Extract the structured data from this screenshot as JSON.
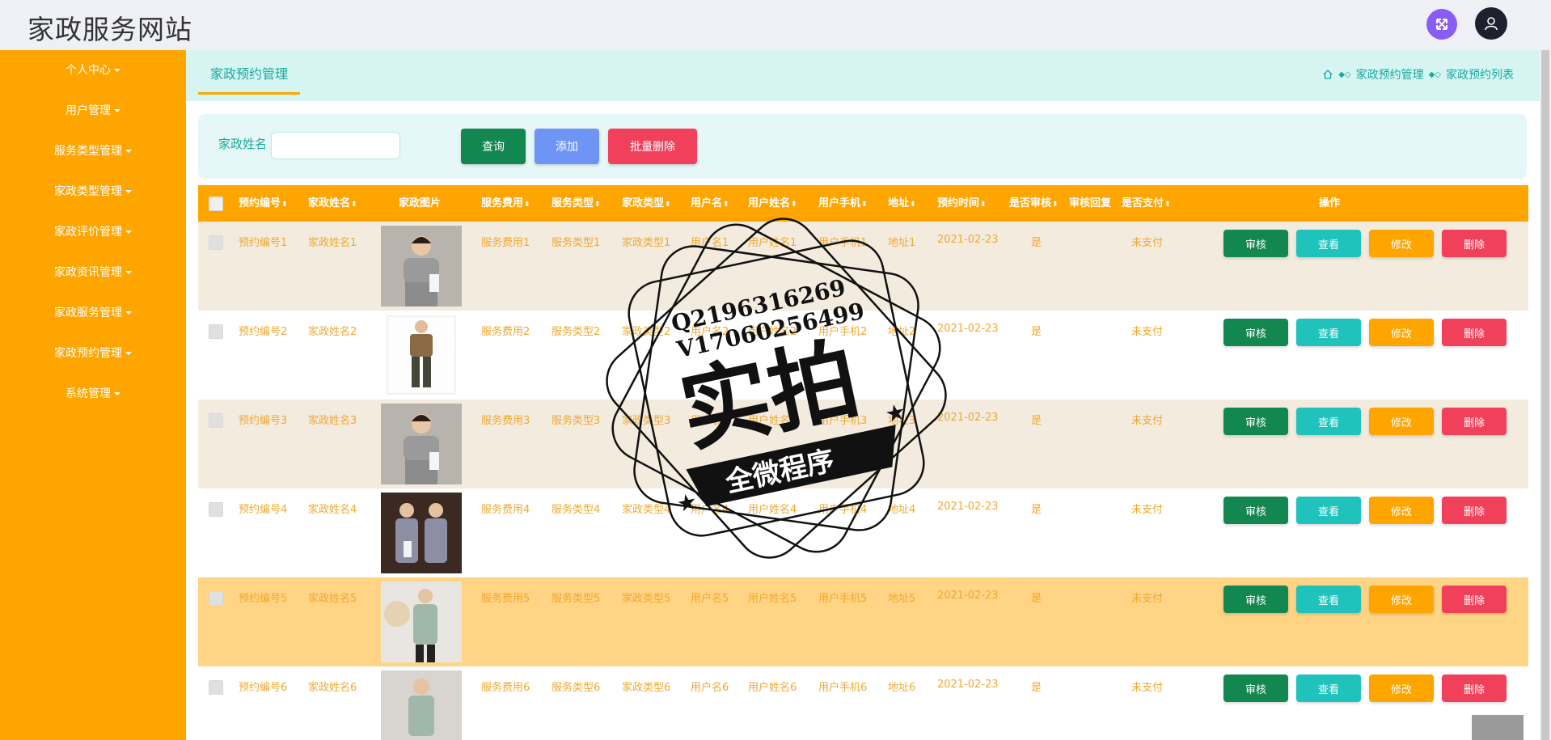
{
  "header": {
    "title": "家政服务网站"
  },
  "sidebar": {
    "items": [
      {
        "label": "个人中心"
      },
      {
        "label": "用户管理"
      },
      {
        "label": "服务类型管理"
      },
      {
        "label": "家政类型管理"
      },
      {
        "label": "家政评价管理"
      },
      {
        "label": "家政资讯管理"
      },
      {
        "label": "家政服务管理"
      },
      {
        "label": "家政预约管理"
      },
      {
        "label": "系统管理"
      }
    ]
  },
  "page": {
    "tab": "家政预约管理",
    "breadcrumb": [
      "家政预约管理",
      "家政预约列表"
    ]
  },
  "search": {
    "label": "家政姓名",
    "value": "",
    "placeholder": "",
    "query_label": "查询",
    "add_label": "添加",
    "batch_delete_label": "批量删除"
  },
  "table": {
    "headers": [
      "预约编号",
      "家政姓名",
      "家政图片",
      "服务费用",
      "服务类型",
      "家政类型",
      "用户名",
      "用户姓名",
      "用户手机",
      "地址",
      "预约时间",
      "是否审核",
      "审核回复",
      "是否支付",
      "操作"
    ],
    "rows": [
      {
        "id": "预约编号1",
        "name": "家政姓名1",
        "fee": "服务费用1",
        "stype": "服务类型1",
        "htype": "家政类型1",
        "user": "用户名1",
        "uname": "用户姓名1",
        "phone": "用户手机1",
        "addr": "地址1",
        "time": "2021-02-23",
        "audit": "是",
        "reply": "",
        "paid": "未支付"
      },
      {
        "id": "预约编号2",
        "name": "家政姓名2",
        "fee": "服务费用2",
        "stype": "服务类型2",
        "htype": "家政类型2",
        "user": "用户名2",
        "uname": "用户姓名2",
        "phone": "用户手机2",
        "addr": "地址2",
        "time": "2021-02-23",
        "audit": "是",
        "reply": "",
        "paid": "未支付"
      },
      {
        "id": "预约编号3",
        "name": "家政姓名3",
        "fee": "服务费用3",
        "stype": "服务类型3",
        "htype": "家政类型3",
        "user": "用户名3",
        "uname": "用户姓名3",
        "phone": "用户手机3",
        "addr": "地址3",
        "time": "2021-02-23",
        "audit": "是",
        "reply": "",
        "paid": "未支付"
      },
      {
        "id": "预约编号4",
        "name": "家政姓名4",
        "fee": "服务费用4",
        "stype": "服务类型4",
        "htype": "家政类型4",
        "user": "用户名4",
        "uname": "用户姓名4",
        "phone": "用户手机4",
        "addr": "地址4",
        "time": "2021-02-23",
        "audit": "是",
        "reply": "",
        "paid": "未支付"
      },
      {
        "id": "预约编号5",
        "name": "家政姓名5",
        "fee": "服务费用5",
        "stype": "服务类型5",
        "htype": "家政类型5",
        "user": "用户名5",
        "uname": "用户姓名5",
        "phone": "用户手机5",
        "addr": "地址5",
        "time": "2021-02-23",
        "audit": "是",
        "reply": "",
        "paid": "未支付"
      },
      {
        "id": "预约编号6",
        "name": "家政姓名6",
        "fee": "服务费用6",
        "stype": "服务类型6",
        "htype": "家政类型6",
        "user": "用户名6",
        "uname": "用户姓名6",
        "phone": "用户手机6",
        "addr": "地址6",
        "time": "2021-02-23",
        "audit": "是",
        "reply": "",
        "paid": "未支付"
      }
    ],
    "actions": {
      "audit": "审核",
      "view": "查看",
      "edit": "修改",
      "delete": "删除"
    }
  },
  "watermark": {
    "line1": "Q2196316269",
    "line2": "V17060256499",
    "big": "实拍",
    "banner": "全微程序"
  },
  "colors": {
    "accent": "#ffa500",
    "teal": "#17a9a0",
    "green": "#12874f",
    "red": "#f1405a",
    "blue": "#6e95f5",
    "cyan": "#20c2bc"
  }
}
